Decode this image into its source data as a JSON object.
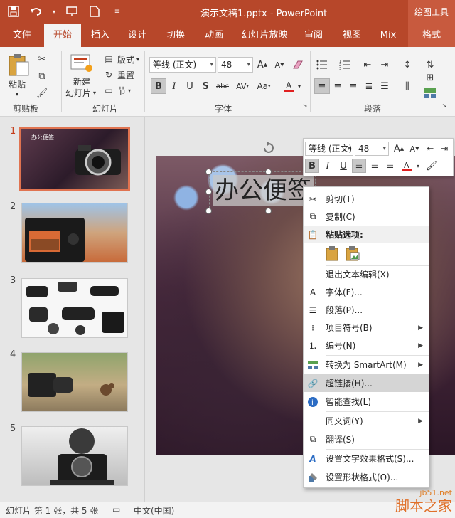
{
  "window": {
    "title": "演示文稿1.pptx - PowerPoint",
    "contextual_tab": "绘图工具"
  },
  "tabs": [
    {
      "label": "文件"
    },
    {
      "label": "开始"
    },
    {
      "label": "插入"
    },
    {
      "label": "设计"
    },
    {
      "label": "切换"
    },
    {
      "label": "动画"
    },
    {
      "label": "幻灯片放映"
    },
    {
      "label": "审阅"
    },
    {
      "label": "视图"
    },
    {
      "label": "Mix"
    },
    {
      "label": "格式"
    }
  ],
  "ribbon": {
    "clipboard": {
      "paste": "粘贴",
      "group": "剪贴板"
    },
    "slides": {
      "new_slide_1": "新建",
      "new_slide_2": "幻灯片",
      "layout": "版式",
      "reset": "重置",
      "section": "节",
      "group": "幻灯片"
    },
    "font": {
      "name": "等线 (正文)",
      "size": "48",
      "group": "字体",
      "shadow": "S",
      "strike": "abc",
      "spacing": "AV",
      "case": "Aa"
    },
    "paragraph": {
      "group": "段落"
    }
  },
  "thumbnails": [
    {
      "number": "1",
      "caption": "办公便签"
    },
    {
      "number": "2"
    },
    {
      "number": "3"
    },
    {
      "number": "4"
    },
    {
      "number": "5"
    }
  ],
  "slide": {
    "title_text": "办公便签"
  },
  "minibar": {
    "font": "等线 (正文)",
    "size": "48"
  },
  "context_menu": [
    {
      "label": "剪切(T)",
      "icon": "scissors-icon"
    },
    {
      "label": "复制(C)",
      "icon": "copy-icon"
    },
    {
      "label": "粘贴选项:",
      "icon": "paste-icon"
    },
    {
      "label": "退出文本编辑(X)"
    },
    {
      "label": "字体(F)...",
      "icon": "font-icon"
    },
    {
      "label": "段落(P)...",
      "icon": "paragraph-icon"
    },
    {
      "label": "项目符号(B)",
      "icon": "bullets-icon"
    },
    {
      "label": "编号(N)",
      "icon": "numbering-icon"
    },
    {
      "label": "转换为 SmartArt(M)",
      "icon": "smartart-icon"
    },
    {
      "label": "超链接(H)...",
      "icon": "hyperlink-icon"
    },
    {
      "label": "智能查找(L)",
      "icon": "smart-lookup-icon"
    },
    {
      "label": "同义词(Y)"
    },
    {
      "label": "翻译(S)",
      "icon": "translate-icon"
    },
    {
      "label": "设置文字效果格式(S)...",
      "icon": "text-effects-icon"
    },
    {
      "label": "设置形状格式(O)...",
      "icon": "shape-format-icon"
    }
  ],
  "status": {
    "slide_info": "幻灯片 第 1 张，共 5 张",
    "language": "中文(中国)"
  },
  "watermark": {
    "site": "jb51.net",
    "name": "脚本之家"
  },
  "colors": {
    "accent": "#b7472a",
    "selection": "#e07350"
  }
}
